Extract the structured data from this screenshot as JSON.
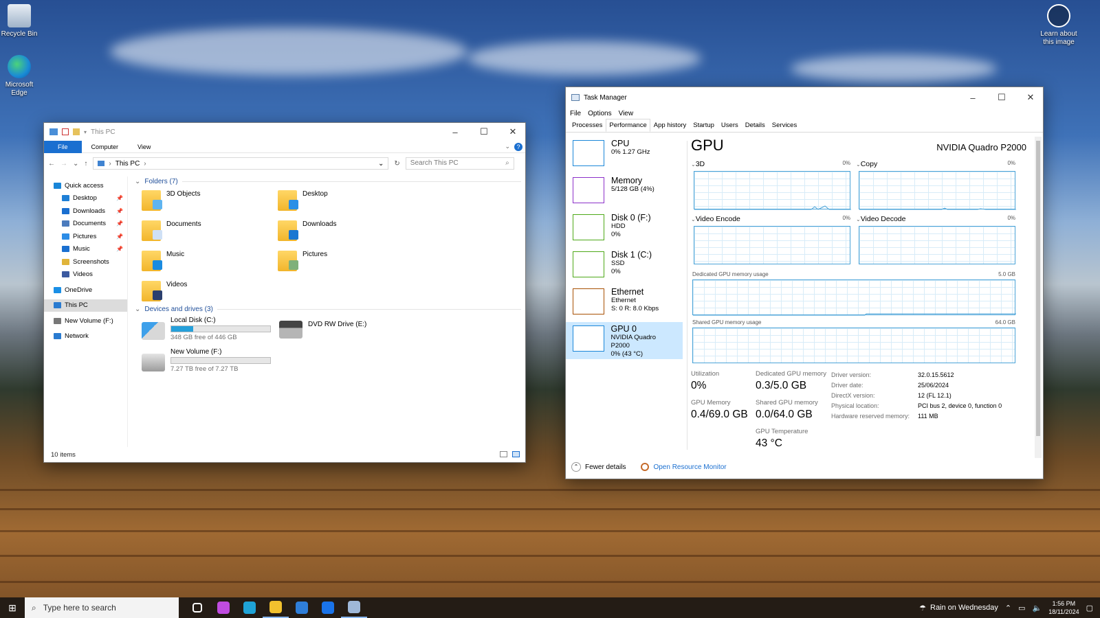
{
  "desktop": {
    "icons": [
      {
        "label": "Recycle Bin",
        "icon": "recycle-bin-icon"
      },
      {
        "label": "Microsoft Edge",
        "icon": "edge-icon"
      },
      {
        "label": "Learn about this image",
        "icon": "camera-icon"
      }
    ]
  },
  "explorer": {
    "title": "This PC",
    "ribbon_tabs": [
      "File",
      "Computer",
      "View"
    ],
    "address": "This PC",
    "search_placeholder": "Search This PC",
    "nav": [
      {
        "label": "Quick access",
        "pinned": false
      },
      {
        "label": "Desktop",
        "pinned": true
      },
      {
        "label": "Downloads",
        "pinned": true
      },
      {
        "label": "Documents",
        "pinned": true
      },
      {
        "label": "Pictures",
        "pinned": true
      },
      {
        "label": "Music",
        "pinned": true
      },
      {
        "label": "Screenshots",
        "pinned": false
      },
      {
        "label": "Videos",
        "pinned": false
      },
      {
        "label": "OneDrive",
        "pinned": false
      },
      {
        "label": "This PC",
        "pinned": false
      },
      {
        "label": "New Volume (F:)",
        "pinned": false
      },
      {
        "label": "Network",
        "pinned": false
      }
    ],
    "folders_header": "Folders (7)",
    "folders": [
      "3D Objects",
      "Desktop",
      "Documents",
      "Downloads",
      "Music",
      "Pictures",
      "Videos"
    ],
    "drives_header": "Devices and drives (3)",
    "drives": [
      {
        "name": "Local Disk (C:)",
        "free": "348 GB free of 446 GB",
        "used_fraction": 0.22
      },
      {
        "name": "DVD RW Drive (E:)",
        "free": "",
        "used_fraction": null
      },
      {
        "name": "New Volume (F:)",
        "free": "7.27 TB free of 7.27 TB",
        "used_fraction": 0.0
      }
    ],
    "status": "10 items"
  },
  "taskmgr": {
    "title": "Task Manager",
    "menu": [
      "File",
      "Options",
      "View"
    ],
    "tabs": [
      "Processes",
      "Performance",
      "App history",
      "Startup",
      "Users",
      "Details",
      "Services"
    ],
    "active_tab": "Performance",
    "sidebar": [
      {
        "name": "CPU",
        "l1": "0% 1.27 GHz",
        "l2": "",
        "l3": "",
        "color": "#1a86d8"
      },
      {
        "name": "Memory",
        "l1": "5/128 GB (4%)",
        "l2": "",
        "l3": "",
        "color": "#8b2fc9"
      },
      {
        "name": "Disk 0 (F:)",
        "l1": "HDD",
        "l2": "0%",
        "l3": "",
        "color": "#4da817"
      },
      {
        "name": "Disk 1 (C:)",
        "l1": "SSD",
        "l2": "0%",
        "l3": "",
        "color": "#4da817"
      },
      {
        "name": "Ethernet",
        "l1": "Ethernet",
        "l2": "S: 0 R: 8.0 Kbps",
        "l3": "",
        "color": "#a74f01"
      },
      {
        "name": "GPU 0",
        "l1": "NVIDIA Quadro P2000",
        "l2": "0% (43 °C)",
        "l3": "",
        "color": "#1a86d8"
      }
    ],
    "gpu": {
      "title": "GPU",
      "model": "NVIDIA Quadro P2000",
      "engines": [
        {
          "name": "3D",
          "pct": "0%"
        },
        {
          "name": "Copy",
          "pct": "0%"
        },
        {
          "name": "Video Encode",
          "pct": "0%"
        },
        {
          "name": "Video Decode",
          "pct": "0%"
        }
      ],
      "dedicated_label": "Dedicated GPU memory usage",
      "dedicated_max": "5.0 GB",
      "shared_label": "Shared GPU memory usage",
      "shared_max": "64.0 GB",
      "stats": {
        "utilization_label": "Utilization",
        "utilization": "0%",
        "dedicated_label": "Dedicated GPU memory",
        "dedicated": "0.3/5.0 GB",
        "gpumem_label": "GPU Memory",
        "gpumem": "0.4/69.0 GB",
        "shared_label": "Shared GPU memory",
        "shared": "0.0/64.0 GB",
        "temp_label": "GPU Temperature",
        "temp": "43 °C"
      },
      "info": [
        {
          "k": "Driver version:",
          "v": "32.0.15.5612"
        },
        {
          "k": "Driver date:",
          "v": "25/06/2024"
        },
        {
          "k": "DirectX version:",
          "v": "12 (FL 12.1)"
        },
        {
          "k": "Physical location:",
          "v": "PCI bus 2, device 0, function 0"
        },
        {
          "k": "Hardware reserved memory:",
          "v": "111 MB"
        }
      ]
    },
    "footer": {
      "fewer": "Fewer details",
      "monitor": "Open Resource Monitor"
    }
  },
  "taskbar": {
    "search_placeholder": "Type here to search",
    "weather": "Rain on Wednesday",
    "time": "1:56 PM",
    "date": "18/11/2024",
    "apps": [
      {
        "icon": "task-view-icon",
        "color": "#ffffff"
      },
      {
        "icon": "copilot-icon",
        "color": "#c04ce0"
      },
      {
        "icon": "edge-icon",
        "color": "#1fa3d6"
      },
      {
        "icon": "file-explorer-icon",
        "color": "#f2c12e"
      },
      {
        "icon": "store-icon",
        "color": "#2f7ed8"
      },
      {
        "icon": "mail-icon",
        "color": "#1a73e8"
      },
      {
        "icon": "task-manager-icon",
        "color": "#9fb8d8"
      }
    ]
  }
}
